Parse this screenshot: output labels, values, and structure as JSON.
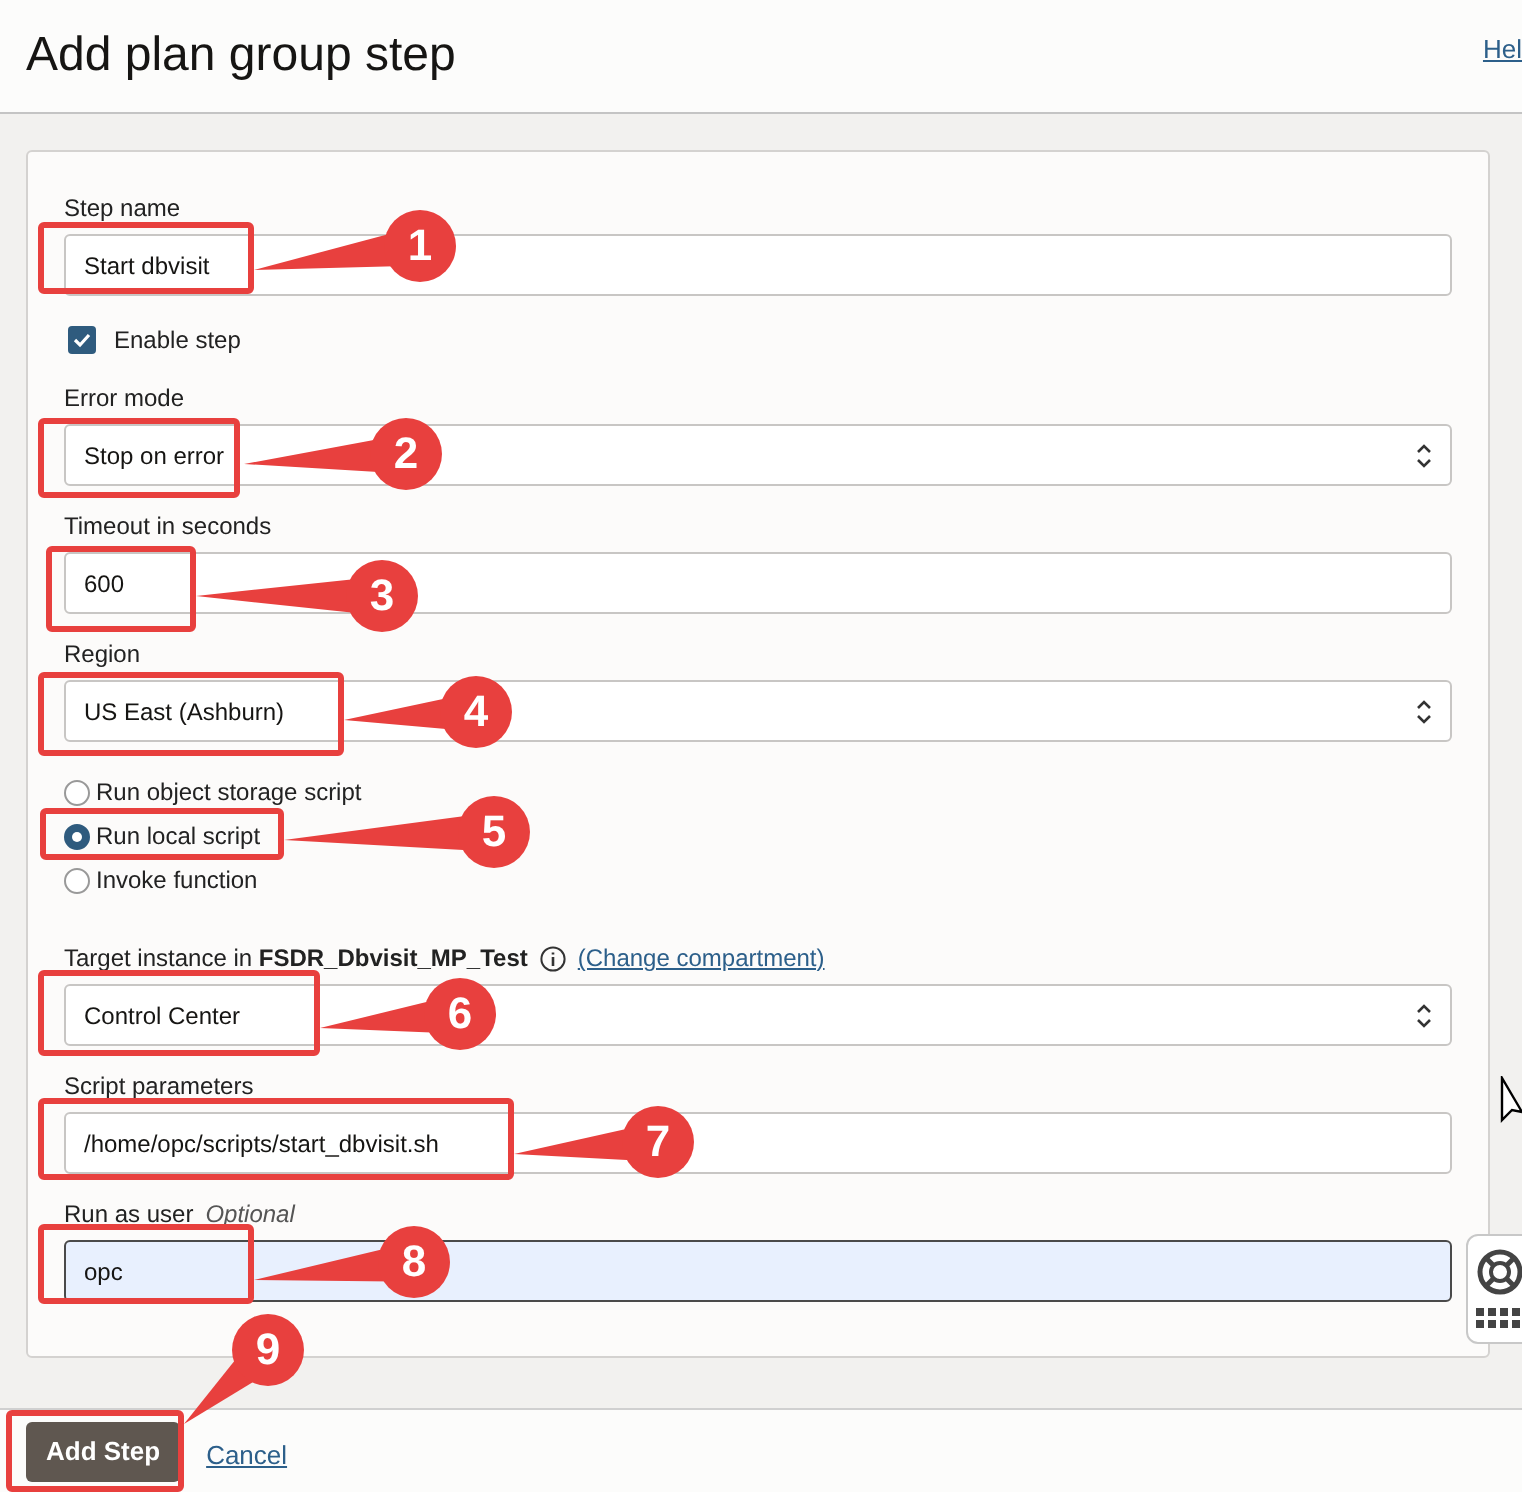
{
  "header": {
    "title": "Add plan group step",
    "help_link": "Hel"
  },
  "fields": [
    {
      "kind": "text",
      "label": "Step name",
      "value": "Start dbvisit"
    },
    {
      "kind": "checkbox",
      "label": "Enable step",
      "checked": true
    },
    {
      "kind": "select",
      "label": "Error mode",
      "value": "Stop on error"
    },
    {
      "kind": "text",
      "label": "Timeout in seconds",
      "value": "600"
    },
    {
      "kind": "select",
      "label": "Region",
      "value": "US East (Ashburn)"
    },
    {
      "kind": "radios",
      "options": [
        {
          "label": "Run object storage script",
          "selected": false
        },
        {
          "label": "Run local script",
          "selected": true
        },
        {
          "label": "Invoke function",
          "selected": false
        }
      ]
    },
    {
      "kind": "select",
      "label": "Target instance in **FSDR_Dbvisit_MP_Test**",
      "link": "(Change compartment)",
      "value": "Control Center"
    },
    {
      "kind": "text",
      "label": "Script parameters",
      "value": "/home/opc/scripts/start_dbvisit.sh"
    },
    {
      "kind": "text",
      "label": "Run as user",
      "hint": "Optional",
      "value": "opc",
      "focused": true
    }
  ],
  "footer": {
    "primary": "Add Step",
    "cancel": "Cancel"
  },
  "callouts": [
    {
      "number": "1"
    },
    {
      "number": "2"
    },
    {
      "number": "3"
    },
    {
      "number": "4"
    },
    {
      "number": "5"
    },
    {
      "number": "6"
    },
    {
      "number": "7"
    },
    {
      "number": "8"
    },
    {
      "number": "9"
    }
  ]
}
